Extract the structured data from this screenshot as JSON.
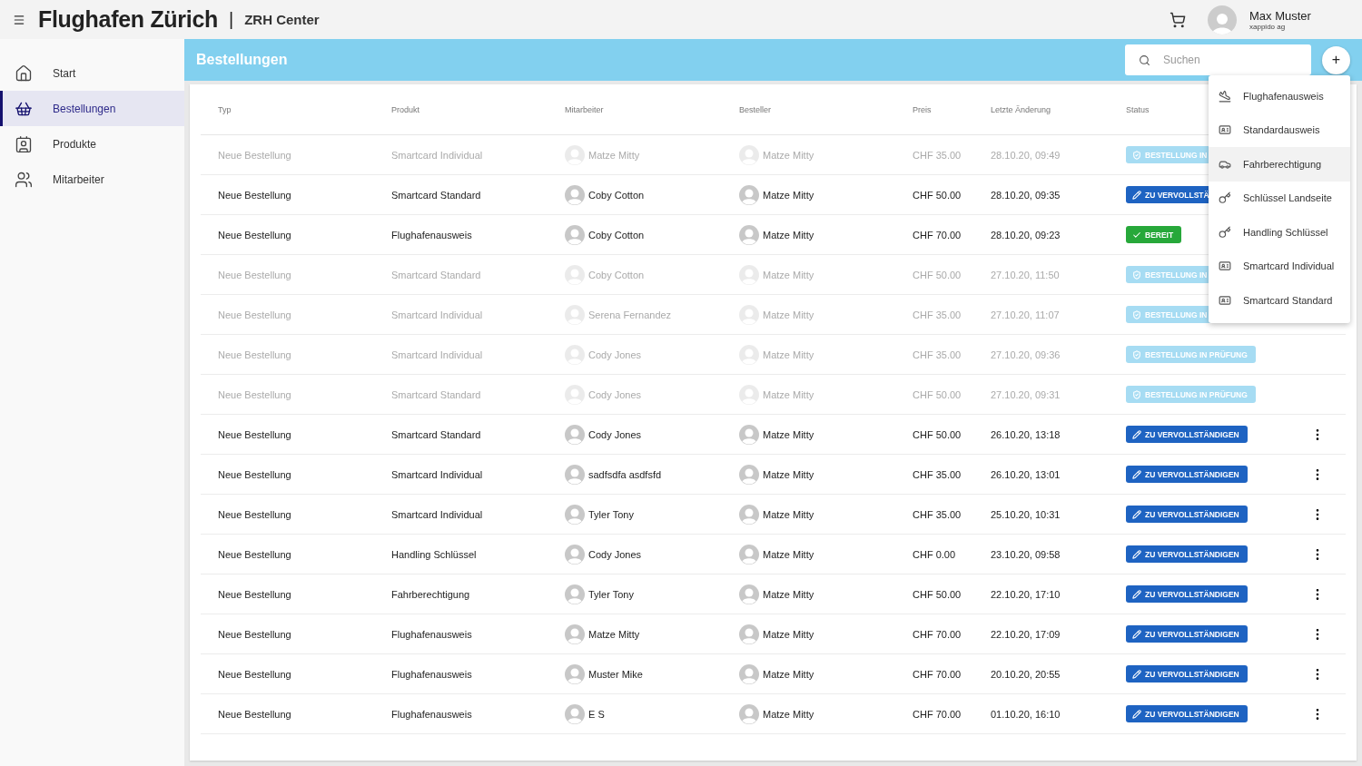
{
  "header": {
    "brand": "Flughafen Zürich",
    "separator": "|",
    "app_name": "ZRH Center",
    "user": {
      "name": "Max Muster",
      "company": "xappido ag"
    }
  },
  "sidebar": {
    "items": [
      {
        "label": "Start",
        "kind": "home",
        "selected": false
      },
      {
        "label": "Bestellungen",
        "kind": "basket",
        "selected": true
      },
      {
        "label": "Produkte",
        "kind": "badge",
        "selected": false
      },
      {
        "label": "Mitarbeiter",
        "kind": "people",
        "selected": false
      }
    ]
  },
  "page": {
    "title": "Bestellungen",
    "search": {
      "placeholder": "Suchen"
    },
    "add_button": "+"
  },
  "table": {
    "columns": [
      "Typ",
      "Produkt",
      "Mitarbeiter",
      "Besteller",
      "Preis",
      "Letzte Änderung",
      "Status"
    ],
    "rows": [
      {
        "typ": "Neue Bestellung",
        "produkt": "Smartcard Individual",
        "mitarbeiter": "Matze Mitty",
        "besteller": "Matze Mitty",
        "preis": "CHF 35.00",
        "datum": "28.10.20, 09:49",
        "status": {
          "kind": "review",
          "label": "BESTELLUNG IN"
        },
        "dimmed": true,
        "menu": false
      },
      {
        "typ": "Neue Bestellung",
        "produkt": "Smartcard Standard",
        "mitarbeiter": "Coby Cotton",
        "besteller": "Matze Mitty",
        "preis": "CHF 50.00",
        "datum": "28.10.20, 09:35",
        "status": {
          "kind": "complete",
          "label": "ZU VERVOLLSTÄ"
        },
        "dimmed": false,
        "menu": false
      },
      {
        "typ": "Neue Bestellung",
        "produkt": "Flughafenausweis",
        "mitarbeiter": "Coby Cotton",
        "besteller": "Matze Mitty",
        "preis": "CHF 70.00",
        "datum": "28.10.20, 09:23",
        "status": {
          "kind": "ready",
          "label": "BEREIT"
        },
        "dimmed": false,
        "menu": false
      },
      {
        "typ": "Neue Bestellung",
        "produkt": "Smartcard Standard",
        "mitarbeiter": "Coby Cotton",
        "besteller": "Matze Mitty",
        "preis": "CHF 50.00",
        "datum": "27.10.20, 11:50",
        "status": {
          "kind": "review",
          "label": "BESTELLUNG IN"
        },
        "dimmed": true,
        "menu": false
      },
      {
        "typ": "Neue Bestellung",
        "produkt": "Smartcard Individual",
        "mitarbeiter": "Serena Fernandez",
        "besteller": "Matze Mitty",
        "preis": "CHF 35.00",
        "datum": "27.10.20, 11:07",
        "status": {
          "kind": "review",
          "label": "BESTELLUNG IN"
        },
        "dimmed": true,
        "menu": false
      },
      {
        "typ": "Neue Bestellung",
        "produkt": "Smartcard Individual",
        "mitarbeiter": "Cody Jones",
        "besteller": "Matze Mitty",
        "preis": "CHF 35.00",
        "datum": "27.10.20, 09:36",
        "status": {
          "kind": "review",
          "label": "BESTELLUNG IN PRÜFUNG"
        },
        "dimmed": true,
        "menu": false
      },
      {
        "typ": "Neue Bestellung",
        "produkt": "Smartcard Standard",
        "mitarbeiter": "Cody Jones",
        "besteller": "Matze Mitty",
        "preis": "CHF 50.00",
        "datum": "27.10.20, 09:31",
        "status": {
          "kind": "review",
          "label": "BESTELLUNG IN PRÜFUNG"
        },
        "dimmed": true,
        "menu": false
      },
      {
        "typ": "Neue Bestellung",
        "produkt": "Smartcard Standard",
        "mitarbeiter": "Cody Jones",
        "besteller": "Matze Mitty",
        "preis": "CHF 50.00",
        "datum": "26.10.20, 13:18",
        "status": {
          "kind": "complete",
          "label": "ZU VERVOLLSTÄNDIGEN"
        },
        "dimmed": false,
        "menu": true
      },
      {
        "typ": "Neue Bestellung",
        "produkt": "Smartcard Individual",
        "mitarbeiter": "sadfsdfa asdfsfd",
        "besteller": "Matze Mitty",
        "preis": "CHF 35.00",
        "datum": "26.10.20, 13:01",
        "status": {
          "kind": "complete",
          "label": "ZU VERVOLLSTÄNDIGEN"
        },
        "dimmed": false,
        "menu": true
      },
      {
        "typ": "Neue Bestellung",
        "produkt": "Smartcard Individual",
        "mitarbeiter": "Tyler Tony",
        "besteller": "Matze Mitty",
        "preis": "CHF 35.00",
        "datum": "25.10.20, 10:31",
        "status": {
          "kind": "complete",
          "label": "ZU VERVOLLSTÄNDIGEN"
        },
        "dimmed": false,
        "menu": true
      },
      {
        "typ": "Neue Bestellung",
        "produkt": "Handling Schlüssel",
        "mitarbeiter": "Cody Jones",
        "besteller": "Matze Mitty",
        "preis": "CHF 0.00",
        "datum": "23.10.20, 09:58",
        "status": {
          "kind": "complete",
          "label": "ZU VERVOLLSTÄNDIGEN"
        },
        "dimmed": false,
        "menu": true
      },
      {
        "typ": "Neue Bestellung",
        "produkt": "Fahrberechtigung",
        "mitarbeiter": "Tyler Tony",
        "besteller": "Matze Mitty",
        "preis": "CHF 50.00",
        "datum": "22.10.20, 17:10",
        "status": {
          "kind": "complete",
          "label": "ZU VERVOLLSTÄNDIGEN"
        },
        "dimmed": false,
        "menu": true
      },
      {
        "typ": "Neue Bestellung",
        "produkt": "Flughafenausweis",
        "mitarbeiter": "Matze Mitty",
        "besteller": "Matze Mitty",
        "preis": "CHF 70.00",
        "datum": "22.10.20, 17:09",
        "status": {
          "kind": "complete",
          "label": "ZU VERVOLLSTÄNDIGEN"
        },
        "dimmed": false,
        "menu": true
      },
      {
        "typ": "Neue Bestellung",
        "produkt": "Flughafenausweis",
        "mitarbeiter": "Muster Mike",
        "besteller": "Matze Mitty",
        "preis": "CHF 70.00",
        "datum": "20.10.20, 20:55",
        "status": {
          "kind": "complete",
          "label": "ZU VERVOLLSTÄNDIGEN"
        },
        "dimmed": false,
        "menu": true
      },
      {
        "typ": "Neue Bestellung",
        "produkt": "Flughafenausweis",
        "mitarbeiter": "E S",
        "besteller": "Matze Mitty",
        "preis": "CHF 70.00",
        "datum": "01.10.20, 16:10",
        "status": {
          "kind": "complete",
          "label": "ZU VERVOLLSTÄNDIGEN"
        },
        "dimmed": false,
        "menu": true
      }
    ]
  },
  "add_menu": {
    "items": [
      {
        "label": "Flughafenausweis",
        "kind": "plane",
        "selected": false
      },
      {
        "label": "Standardausweis",
        "kind": "card",
        "selected": false
      },
      {
        "label": "Fahrberechtigung",
        "kind": "car",
        "selected": true
      },
      {
        "label": "Schlüssel Landseite",
        "kind": "key",
        "selected": false
      },
      {
        "label": "Handling Schlüssel",
        "kind": "key",
        "selected": false
      },
      {
        "label": "Smartcard Individual",
        "kind": "card",
        "selected": false
      },
      {
        "label": "Smartcard Standard",
        "kind": "card",
        "selected": false
      }
    ]
  }
}
